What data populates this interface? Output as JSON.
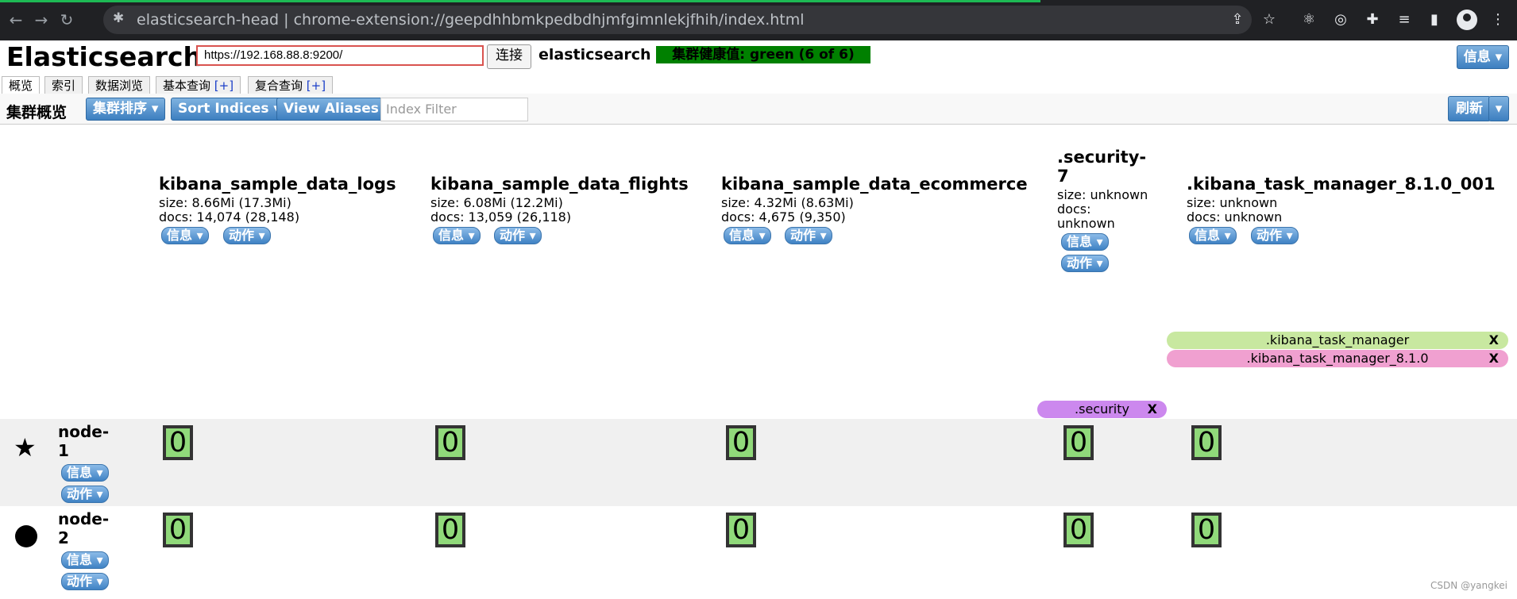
{
  "browser": {
    "tab_title": "elasticsearch-head",
    "separator": "|",
    "url": "chrome-extension://geepdhhbmkpedbdhjmfgimnlekjfhih/index.html"
  },
  "header": {
    "app_title": "Elasticsearch",
    "server_url": "https://192.168.88.8:9200/",
    "connect_label": "连接",
    "cluster_name": "elasticsearch",
    "health_text": "集群健康值: green (6 of 6)",
    "info_label": "信息 ▾"
  },
  "tabs": [
    {
      "label": "概览"
    },
    {
      "label": "索引"
    },
    {
      "label": "数据浏览"
    },
    {
      "label": "基本查询",
      "plus": "[+]"
    },
    {
      "label": "复合查询",
      "plus": "[+]"
    }
  ],
  "toolbar": {
    "title": "集群概览",
    "sort_cluster": "集群排序 ▾",
    "sort_indices": "Sort Indices ▾",
    "view_aliases": "View Aliases ▾",
    "filter_placeholder": "Index Filter",
    "refresh_label": "刷新",
    "refresh_caret": "▾"
  },
  "indices": [
    {
      "name": "kibana_sample_data_logs",
      "size": "size: 8.66Mi (17.3Mi)",
      "docs": "docs: 14,074 (28,148)"
    },
    {
      "name": "kibana_sample_data_flights",
      "size": "size: 6.08Mi (12.2Mi)",
      "docs": "docs: 13,059 (26,118)"
    },
    {
      "name": "kibana_sample_data_ecommerce",
      "size": "size: 4.32Mi (8.63Mi)",
      "docs": "docs: 4,675 (9,350)"
    },
    {
      "name_line1": ".security-",
      "name_line2": "7",
      "size": "size: unknown",
      "docs_line1": "docs:",
      "docs_line2": "unknown"
    },
    {
      "name": ".kibana_task_manager_8.1.0_001",
      "size": "size: unknown",
      "docs": "docs: unknown"
    }
  ],
  "pill_labels": {
    "info": "信息 ▾",
    "action": "动作 ▾"
  },
  "aliases": [
    {
      "label": ".kibana_task_manager",
      "close": "X",
      "color": "#c8e8a0"
    },
    {
      "label": ".kibana_task_manager_8.1.0",
      "close": "X",
      "color": "#f0a0d0"
    },
    {
      "label": ".security",
      "close": "X",
      "color": "#cc88ee"
    }
  ],
  "nodes": [
    {
      "line1": "node-",
      "line2": "1",
      "icon": "star-icon",
      "master": true,
      "shards": [
        "0",
        "0",
        "0",
        "0",
        "0"
      ]
    },
    {
      "line1": "node-",
      "line2": "2",
      "icon": "circle-icon",
      "master": false,
      "shards": [
        "0",
        "0",
        "0",
        "0",
        "0"
      ]
    }
  ],
  "watermark": "CSDN @yangkei"
}
